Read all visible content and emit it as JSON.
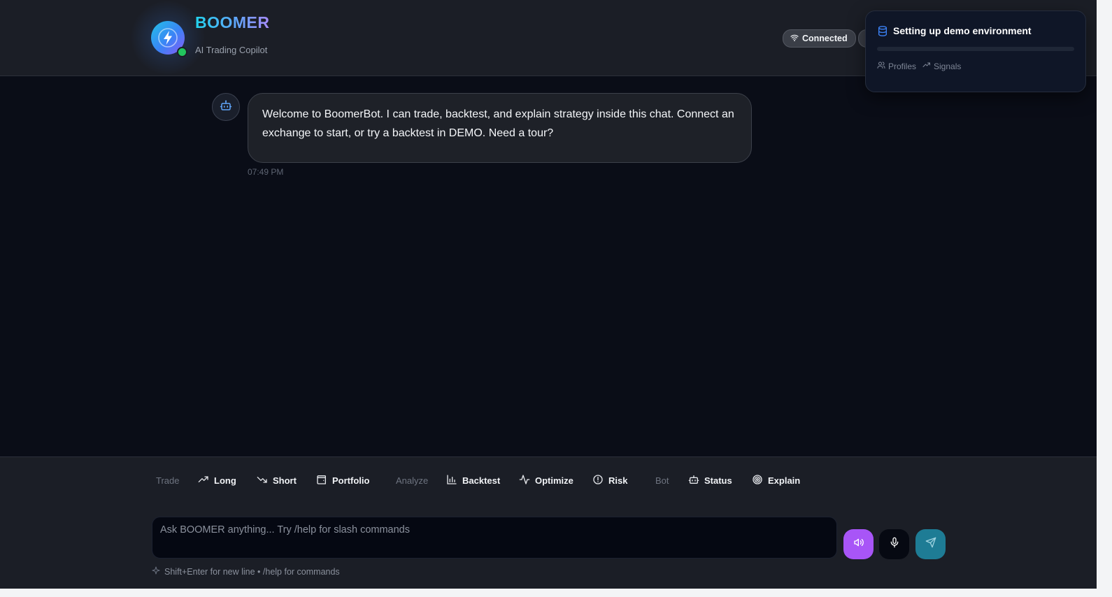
{
  "header": {
    "brand": "BOOMER",
    "tagline": "AI Trading Copilot",
    "connection_status": "Connected",
    "online_color": "#22c55e",
    "logo_icon": "lightning-bolt-icon"
  },
  "toast": {
    "title": "Setting up demo environment",
    "icon": "database-icon",
    "progress": 0,
    "tags": [
      {
        "label": "Profiles",
        "icon": "users-icon"
      },
      {
        "label": "Signals",
        "icon": "trending-up-icon"
      }
    ]
  },
  "chat": {
    "messages": [
      {
        "sender": "bot",
        "avatar_icon": "bot-icon",
        "text": "Welcome to BoomerBot. I can trade, backtest, and explain strategy inside this chat. Connect an exchange to start, or try a backtest in DEMO. Need a tour?",
        "time": "07:49 PM"
      }
    ]
  },
  "quick_actions": {
    "trade": {
      "label": "Trade",
      "items": [
        {
          "label": "Long",
          "icon": "trending-up-icon"
        },
        {
          "label": "Short",
          "icon": "trending-down-icon"
        },
        {
          "label": "Portfolio",
          "icon": "wallet-icon"
        }
      ]
    },
    "analyze": {
      "label": "Analyze",
      "items": [
        {
          "label": "Backtest",
          "icon": "bar-chart-icon"
        },
        {
          "label": "Optimize",
          "icon": "activity-icon"
        },
        {
          "label": "Risk",
          "icon": "alert-circle-icon"
        }
      ]
    },
    "bot": {
      "label": "Bot",
      "items": [
        {
          "label": "Status",
          "icon": "bot-icon"
        },
        {
          "label": "Explain",
          "icon": "target-icon"
        }
      ]
    }
  },
  "composer": {
    "placeholder": "Ask BOOMER anything... Try /help for slash commands",
    "value": "",
    "hint": "Shift+Enter for new line • /help for commands",
    "voice_color": "#a855f7",
    "send_color": "#1e7c95"
  }
}
